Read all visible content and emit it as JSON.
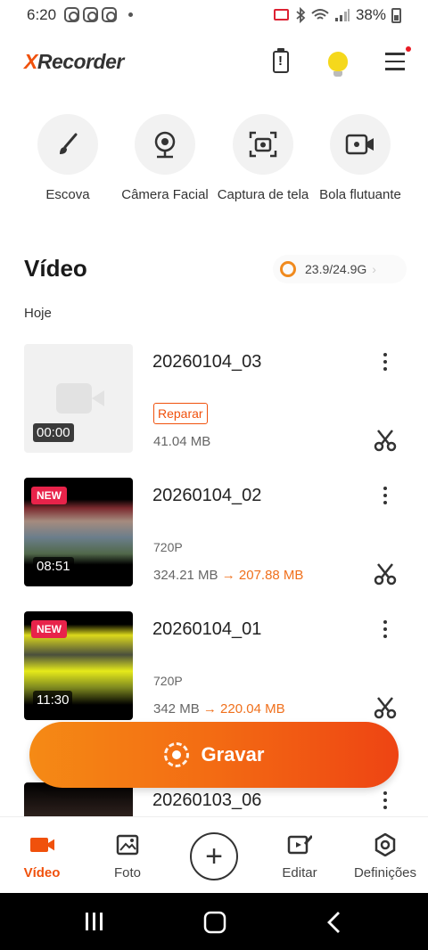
{
  "status_bar": {
    "time": "6:20",
    "battery": "38%"
  },
  "header": {
    "logo_x": "X",
    "logo_rest": "Recorder"
  },
  "tools": [
    {
      "label": "Escova",
      "icon": "brush-icon"
    },
    {
      "label": "Câmera Facial",
      "icon": "face-camera-icon"
    },
    {
      "label": "Captura de tela",
      "icon": "screenshot-icon"
    },
    {
      "label": "Bola flutuante",
      "icon": "floating-ball-icon"
    }
  ],
  "video_section": {
    "title": "Vídeo",
    "storage": "23.9/24.9G",
    "day_label": "Hoje"
  },
  "videos": [
    {
      "name": "20260104_03",
      "duration": "00:00",
      "repair_label": "Reparar",
      "size": "41.04 MB"
    },
    {
      "name": "20260104_02",
      "duration": "08:51",
      "badge": "NEW",
      "resolution": "720P",
      "size": "324.21 MB",
      "arrow": "→",
      "compressed": "207.88 MB"
    },
    {
      "name": "20260104_01",
      "duration": "11:30",
      "badge": "NEW",
      "resolution": "720P",
      "size": "342 MB",
      "arrow": "→",
      "compressed": "220.04 MB"
    },
    {
      "name": "20260103_06"
    }
  ],
  "record_button": {
    "label": "Gravar"
  },
  "bottom_nav": [
    {
      "label": "Vídeo",
      "active": true
    },
    {
      "label": "Foto"
    },
    {
      "label": "Editar"
    },
    {
      "label": "Definições"
    }
  ],
  "colors": {
    "accent": "#f0510c",
    "badge": "#e8234a"
  }
}
